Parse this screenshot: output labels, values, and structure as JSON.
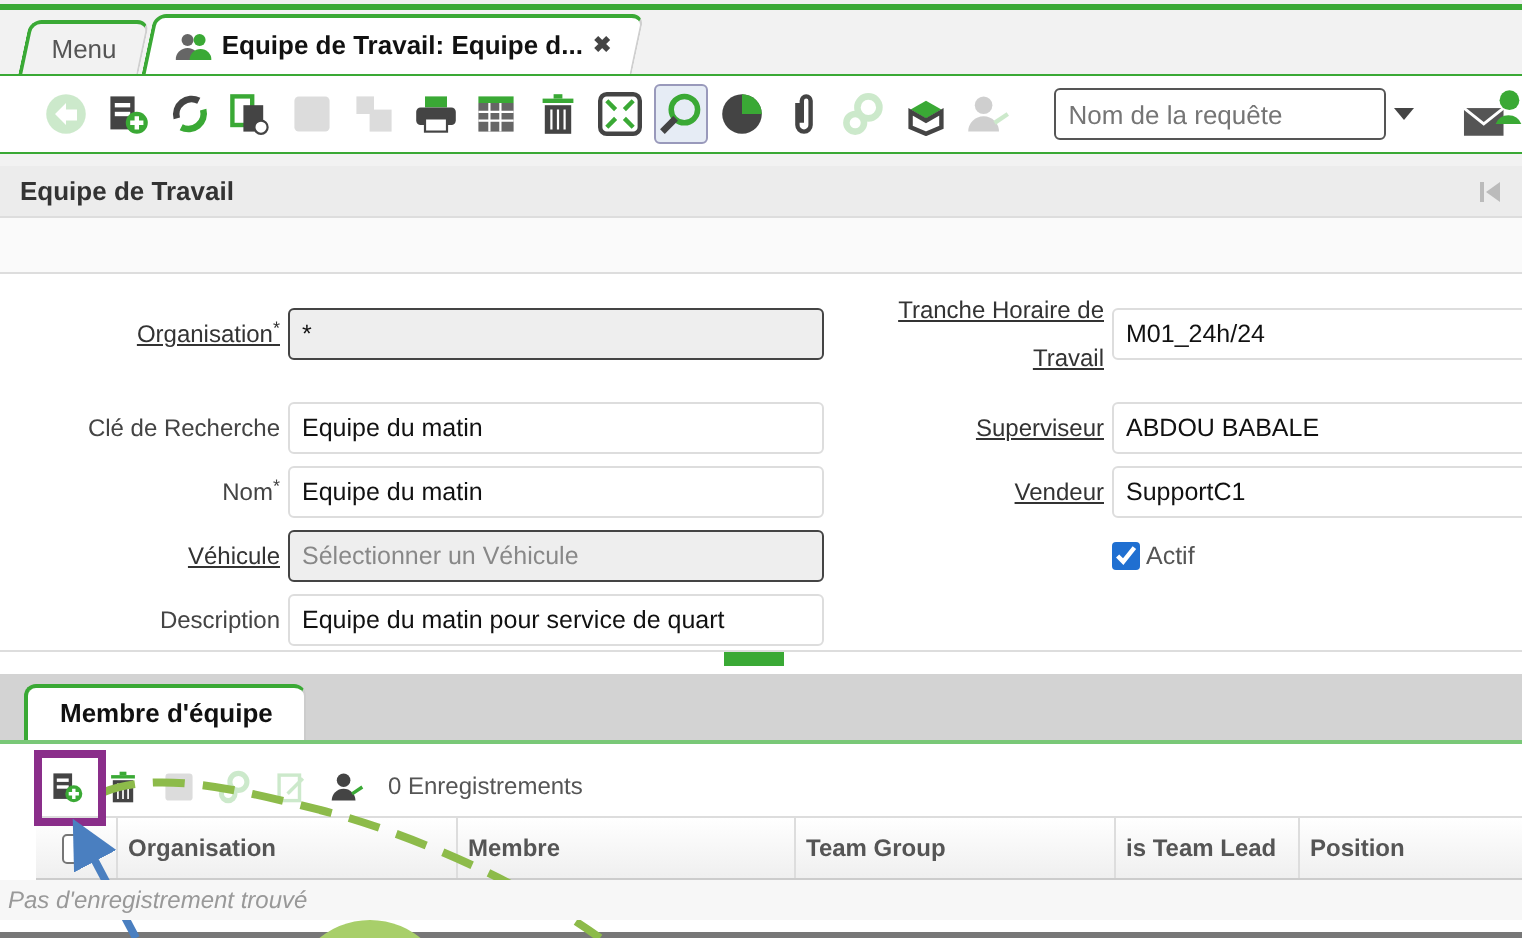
{
  "tabs": [
    {
      "label": "Menu",
      "selected": false,
      "icon": false
    },
    {
      "label": "Equipe de Travail: Equipe d...",
      "selected": true,
      "icon": true,
      "close": "✖"
    }
  ],
  "toolbar": {
    "buttons": [
      {
        "kind": "undo",
        "disabled": true
      },
      {
        "kind": "new",
        "disabled": false
      },
      {
        "kind": "refresh",
        "disabled": false
      },
      {
        "kind": "copy",
        "disabled": false
      },
      {
        "kind": "save",
        "disabled": true
      },
      {
        "kind": "saveNew",
        "disabled": true
      },
      {
        "kind": "print",
        "disabled": false
      },
      {
        "kind": "grid",
        "disabled": false
      },
      {
        "kind": "delete",
        "disabled": false
      },
      {
        "kind": "expand",
        "disabled": false
      },
      {
        "kind": "search",
        "disabled": false,
        "selected": true
      },
      {
        "kind": "chart",
        "disabled": false
      },
      {
        "kind": "attach",
        "disabled": false
      },
      {
        "kind": "process",
        "disabled": true
      },
      {
        "kind": "archive",
        "disabled": false
      },
      {
        "kind": "user",
        "disabled": true
      }
    ],
    "query_placeholder": "Nom de la requête"
  },
  "window_title": "Equipe de Travail",
  "form": [
    {
      "left": {
        "label": "Organisation",
        "link": true,
        "required": true,
        "readonly": true,
        "value": "*"
      },
      "right": {
        "kind": "text",
        "label": "Tranche Horaire de Travail",
        "link": true,
        "required": false,
        "readonly": false,
        "value": "M01_24h/24"
      }
    },
    {
      "left": {
        "label": "Clé de Recherche",
        "link": false,
        "required": false,
        "readonly": false,
        "value": "Equipe du matin"
      },
      "right": {
        "kind": "text",
        "label": "Superviseur",
        "link": true,
        "required": false,
        "readonly": false,
        "value": "ABDOU BABALE"
      }
    },
    {
      "left": {
        "label": "Nom",
        "link": false,
        "required": true,
        "readonly": false,
        "value": "Equipe du matin"
      },
      "right": {
        "kind": "text",
        "label": "Vendeur",
        "link": true,
        "required": false,
        "readonly": false,
        "value": "SupportC1"
      }
    },
    {
      "left": {
        "label": "Véhicule",
        "link": true,
        "required": false,
        "readonly": true,
        "placeholder": "Sélectionner un Véhicule"
      },
      "right": {
        "kind": "checkbox",
        "label": "Actif",
        "checked": true
      }
    },
    {
      "left": {
        "label": "Description",
        "link": false,
        "required": false,
        "readonly": false,
        "value": "Equipe du matin pour service de quart"
      }
    }
  ],
  "detail": {
    "tab": {
      "label": "Membre d'équipe",
      "selected": true
    },
    "toolbar": [
      {
        "kind": "new",
        "disabled": false
      },
      {
        "kind": "delete",
        "disabled": false
      },
      {
        "kind": "save",
        "disabled": true
      },
      {
        "kind": "process",
        "disabled": true
      },
      {
        "kind": "edit",
        "disabled": true
      },
      {
        "kind": "user",
        "disabled": false
      }
    ],
    "record_count": "0 Enregistrements",
    "columns": [
      "Organisation",
      "Membre",
      "Team Group",
      "is Team Lead",
      "Position"
    ],
    "select_all": false,
    "empty_message": "Pas d'enregistrement trouvé"
  }
}
